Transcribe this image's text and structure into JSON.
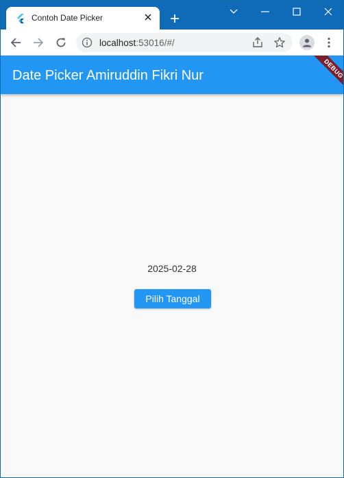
{
  "browser": {
    "tab_title": "Contoh Date Picker",
    "url_host": "localhost",
    "url_rest": ":53016/#/",
    "colors": {
      "titlebar": "#0f6ab8",
      "omnibox": "#f1f3f4"
    }
  },
  "app": {
    "title": "Date Picker Amiruddin Fikri Nur",
    "debug_label": "DEBUG",
    "selected_date": "2025-02-28",
    "button_label": "Pilih Tanggal",
    "colors": {
      "primary": "#2196f3",
      "background": "#f9f9f9"
    }
  },
  "icons": {
    "tab_favicon": "flutter-icon",
    "tab_close": "close-icon",
    "new_tab": "plus-icon",
    "back": "arrow-left-icon",
    "forward": "arrow-right-icon",
    "reload": "reload-icon",
    "site_info": "info-icon",
    "share": "share-icon",
    "bookmark": "star-icon",
    "profile": "person-icon",
    "menu": "kebab-menu-icon"
  }
}
